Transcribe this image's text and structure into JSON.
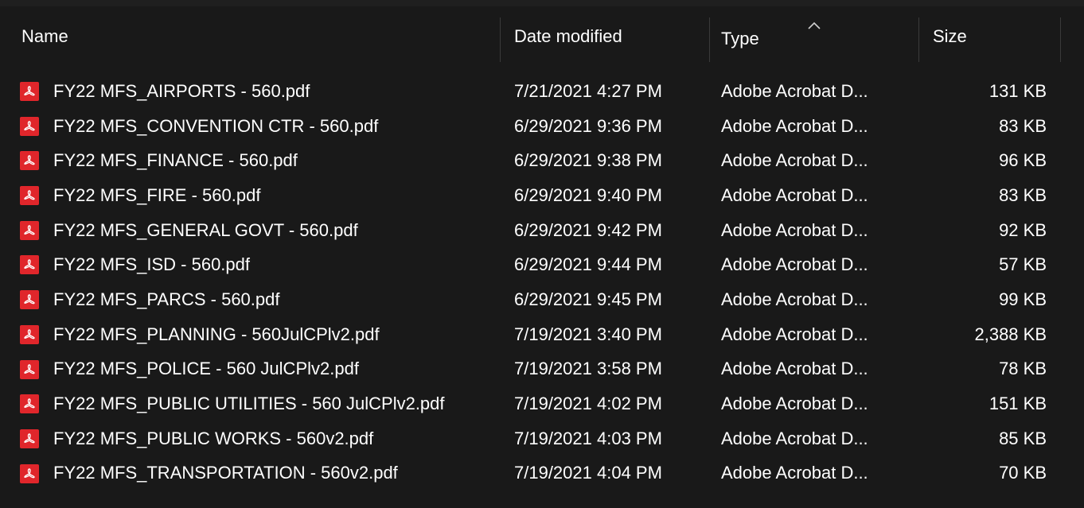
{
  "header": {
    "columns": [
      {
        "key": "name",
        "label": "Name"
      },
      {
        "key": "date",
        "label": "Date modified"
      },
      {
        "key": "type",
        "label": "Type"
      },
      {
        "key": "size",
        "label": "Size"
      }
    ],
    "sorted_column": "type",
    "sort_direction": "ascending"
  },
  "files": [
    {
      "name": "FY22 MFS_AIRPORTS - 560.pdf",
      "date": "7/21/2021 4:27 PM",
      "type": "Adobe Acrobat D...",
      "size": "131 KB",
      "icon": "pdf-icon"
    },
    {
      "name": "FY22 MFS_CONVENTION CTR - 560.pdf",
      "date": "6/29/2021 9:36 PM",
      "type": "Adobe Acrobat D...",
      "size": "83 KB",
      "icon": "pdf-icon"
    },
    {
      "name": "FY22 MFS_FINANCE - 560.pdf",
      "date": "6/29/2021 9:38 PM",
      "type": "Adobe Acrobat D...",
      "size": "96 KB",
      "icon": "pdf-icon"
    },
    {
      "name": "FY22 MFS_FIRE - 560.pdf",
      "date": "6/29/2021 9:40 PM",
      "type": "Adobe Acrobat D...",
      "size": "83 KB",
      "icon": "pdf-icon"
    },
    {
      "name": "FY22 MFS_GENERAL GOVT - 560.pdf",
      "date": "6/29/2021 9:42 PM",
      "type": "Adobe Acrobat D...",
      "size": "92 KB",
      "icon": "pdf-icon"
    },
    {
      "name": "FY22 MFS_ISD - 560.pdf",
      "date": "6/29/2021 9:44 PM",
      "type": "Adobe Acrobat D...",
      "size": "57 KB",
      "icon": "pdf-icon"
    },
    {
      "name": "FY22 MFS_PARCS - 560.pdf",
      "date": "6/29/2021 9:45 PM",
      "type": "Adobe Acrobat D...",
      "size": "99 KB",
      "icon": "pdf-icon"
    },
    {
      "name": "FY22 MFS_PLANNING - 560JulCPlv2.pdf",
      "date": "7/19/2021 3:40 PM",
      "type": "Adobe Acrobat D...",
      "size": "2,388 KB",
      "icon": "pdf-icon"
    },
    {
      "name": "FY22 MFS_POLICE - 560 JulCPlv2.pdf",
      "date": "7/19/2021 3:58 PM",
      "type": "Adobe Acrobat D...",
      "size": "78 KB",
      "icon": "pdf-icon"
    },
    {
      "name": "FY22 MFS_PUBLIC UTILITIES - 560 JulCPlv2.pdf",
      "date": "7/19/2021 4:02 PM",
      "type": "Adobe Acrobat D...",
      "size": "151 KB",
      "icon": "pdf-icon"
    },
    {
      "name": "FY22 MFS_PUBLIC WORKS - 560v2.pdf",
      "date": "7/19/2021 4:03 PM",
      "type": "Adobe Acrobat D...",
      "size": "85 KB",
      "icon": "pdf-icon"
    },
    {
      "name": "FY22 MFS_TRANSPORTATION - 560v2.pdf",
      "date": "7/19/2021 4:04 PM",
      "type": "Adobe Acrobat D...",
      "size": "70 KB",
      "icon": "pdf-icon"
    }
  ],
  "colors": {
    "background": "#191919",
    "text": "#ffffff",
    "pdf_icon": "#e0262b",
    "divider": "#3a3a3a"
  }
}
